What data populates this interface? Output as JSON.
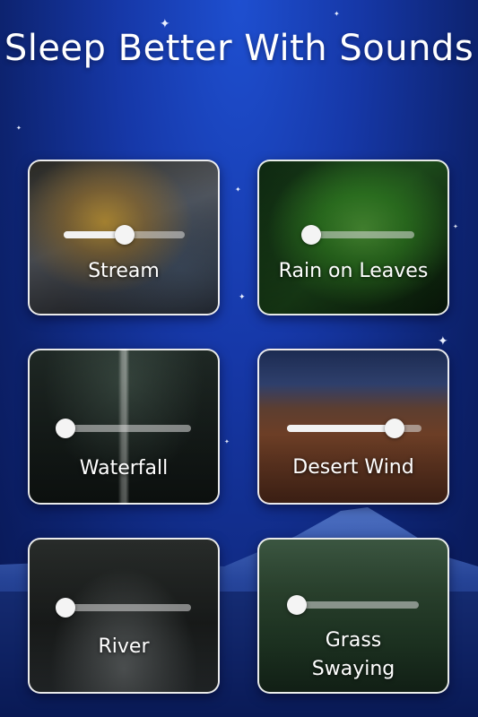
{
  "title": "Sleep Better With Sounds",
  "colors": {
    "background": "#1638a8",
    "card_border": "#ffffff",
    "slider_track": "#9a9a9a",
    "slider_knob": "#f4f4f4"
  },
  "sounds": [
    {
      "label": "Stream",
      "volume": 0.5
    },
    {
      "label": "Rain on Leaves",
      "volume": 0.0
    },
    {
      "label": "Waterfall",
      "volume": 0.0
    },
    {
      "label": "Desert Wind",
      "volume": 0.8
    },
    {
      "label": "River",
      "volume": 0.0
    },
    {
      "label": "Grass Swaying",
      "volume": 0.0
    }
  ]
}
